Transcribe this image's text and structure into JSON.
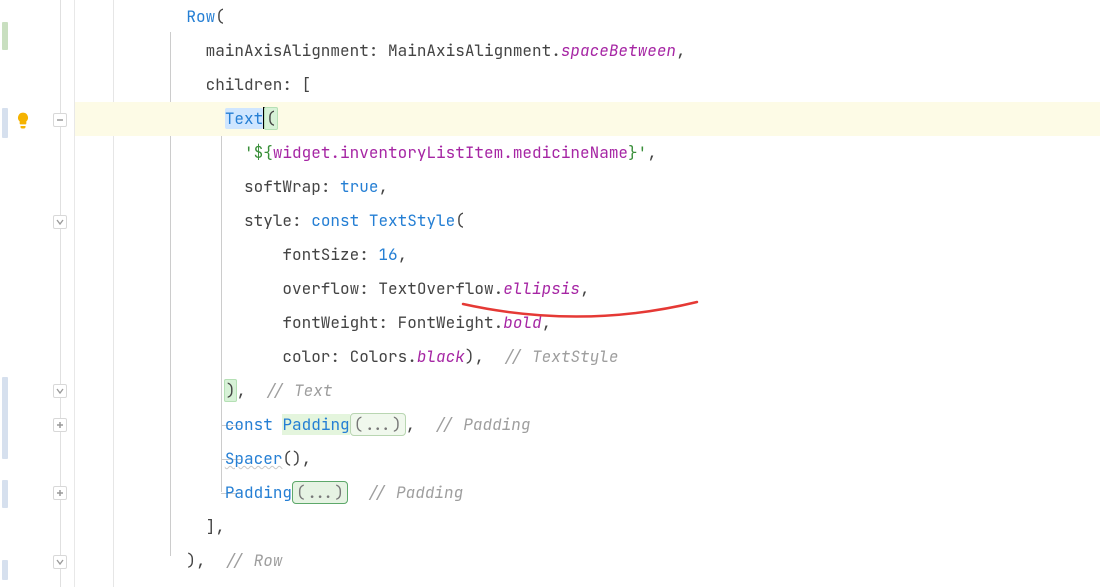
{
  "code": {
    "row_open": "Row",
    "paren_open": "(",
    "mainAxisAlignment_label": "mainAxisAlignment: ",
    "mainAxisAlignment_class": "MainAxisAlignment.",
    "spaceBetween": "spaceBetween",
    "comma": ",",
    "children_label": "children: [",
    "text_widget": "Text",
    "text_paren": "(",
    "string_open": "'",
    "string_interp_open": "${",
    "string_interp_inner": "widget.inventoryListItem.medicineName",
    "string_interp_close": "}",
    "string_close": "'",
    "softWrap_label": "softWrap: ",
    "true_val": "true",
    "style_label": "style: ",
    "const_kw": "const",
    "textStyle": "TextStyle",
    "fontSize_label": "fontSize: ",
    "fontSize_val": "16",
    "overflow_label": "overflow: ",
    "overflow_class": "TextOverflow.",
    "ellipsis": "ellipsis",
    "fontWeight_label": "fontWeight: ",
    "fontWeight_class": "FontWeight.",
    "bold": "bold",
    "color_label": "color: ",
    "colors_class": "Colors.",
    "black": "black",
    "close_paren": ")",
    "paren_comma_space": ",  ",
    "textstyle_comment": "// TextStyle",
    "text_close": ")",
    "text_comment": "// Text",
    "const_padding": "const",
    "padding": "Padding",
    "fold_dots": "(...)",
    "padding_comment": "// Padding",
    "spacer": "Spacer",
    "spacer_parens": "()",
    "padding2": "Padding",
    "padding2_comment": "// Padding",
    "children_close": "],",
    "row_close": ")",
    "row_comment": "// Row"
  },
  "icons": {
    "lightbulb": "lightbulb-icon",
    "fold_minus": "fold-minus-icon",
    "fold_plus": "fold-plus-icon",
    "fold_down": "fold-down-icon"
  },
  "colors": {
    "annotation_red": "#e53935"
  }
}
